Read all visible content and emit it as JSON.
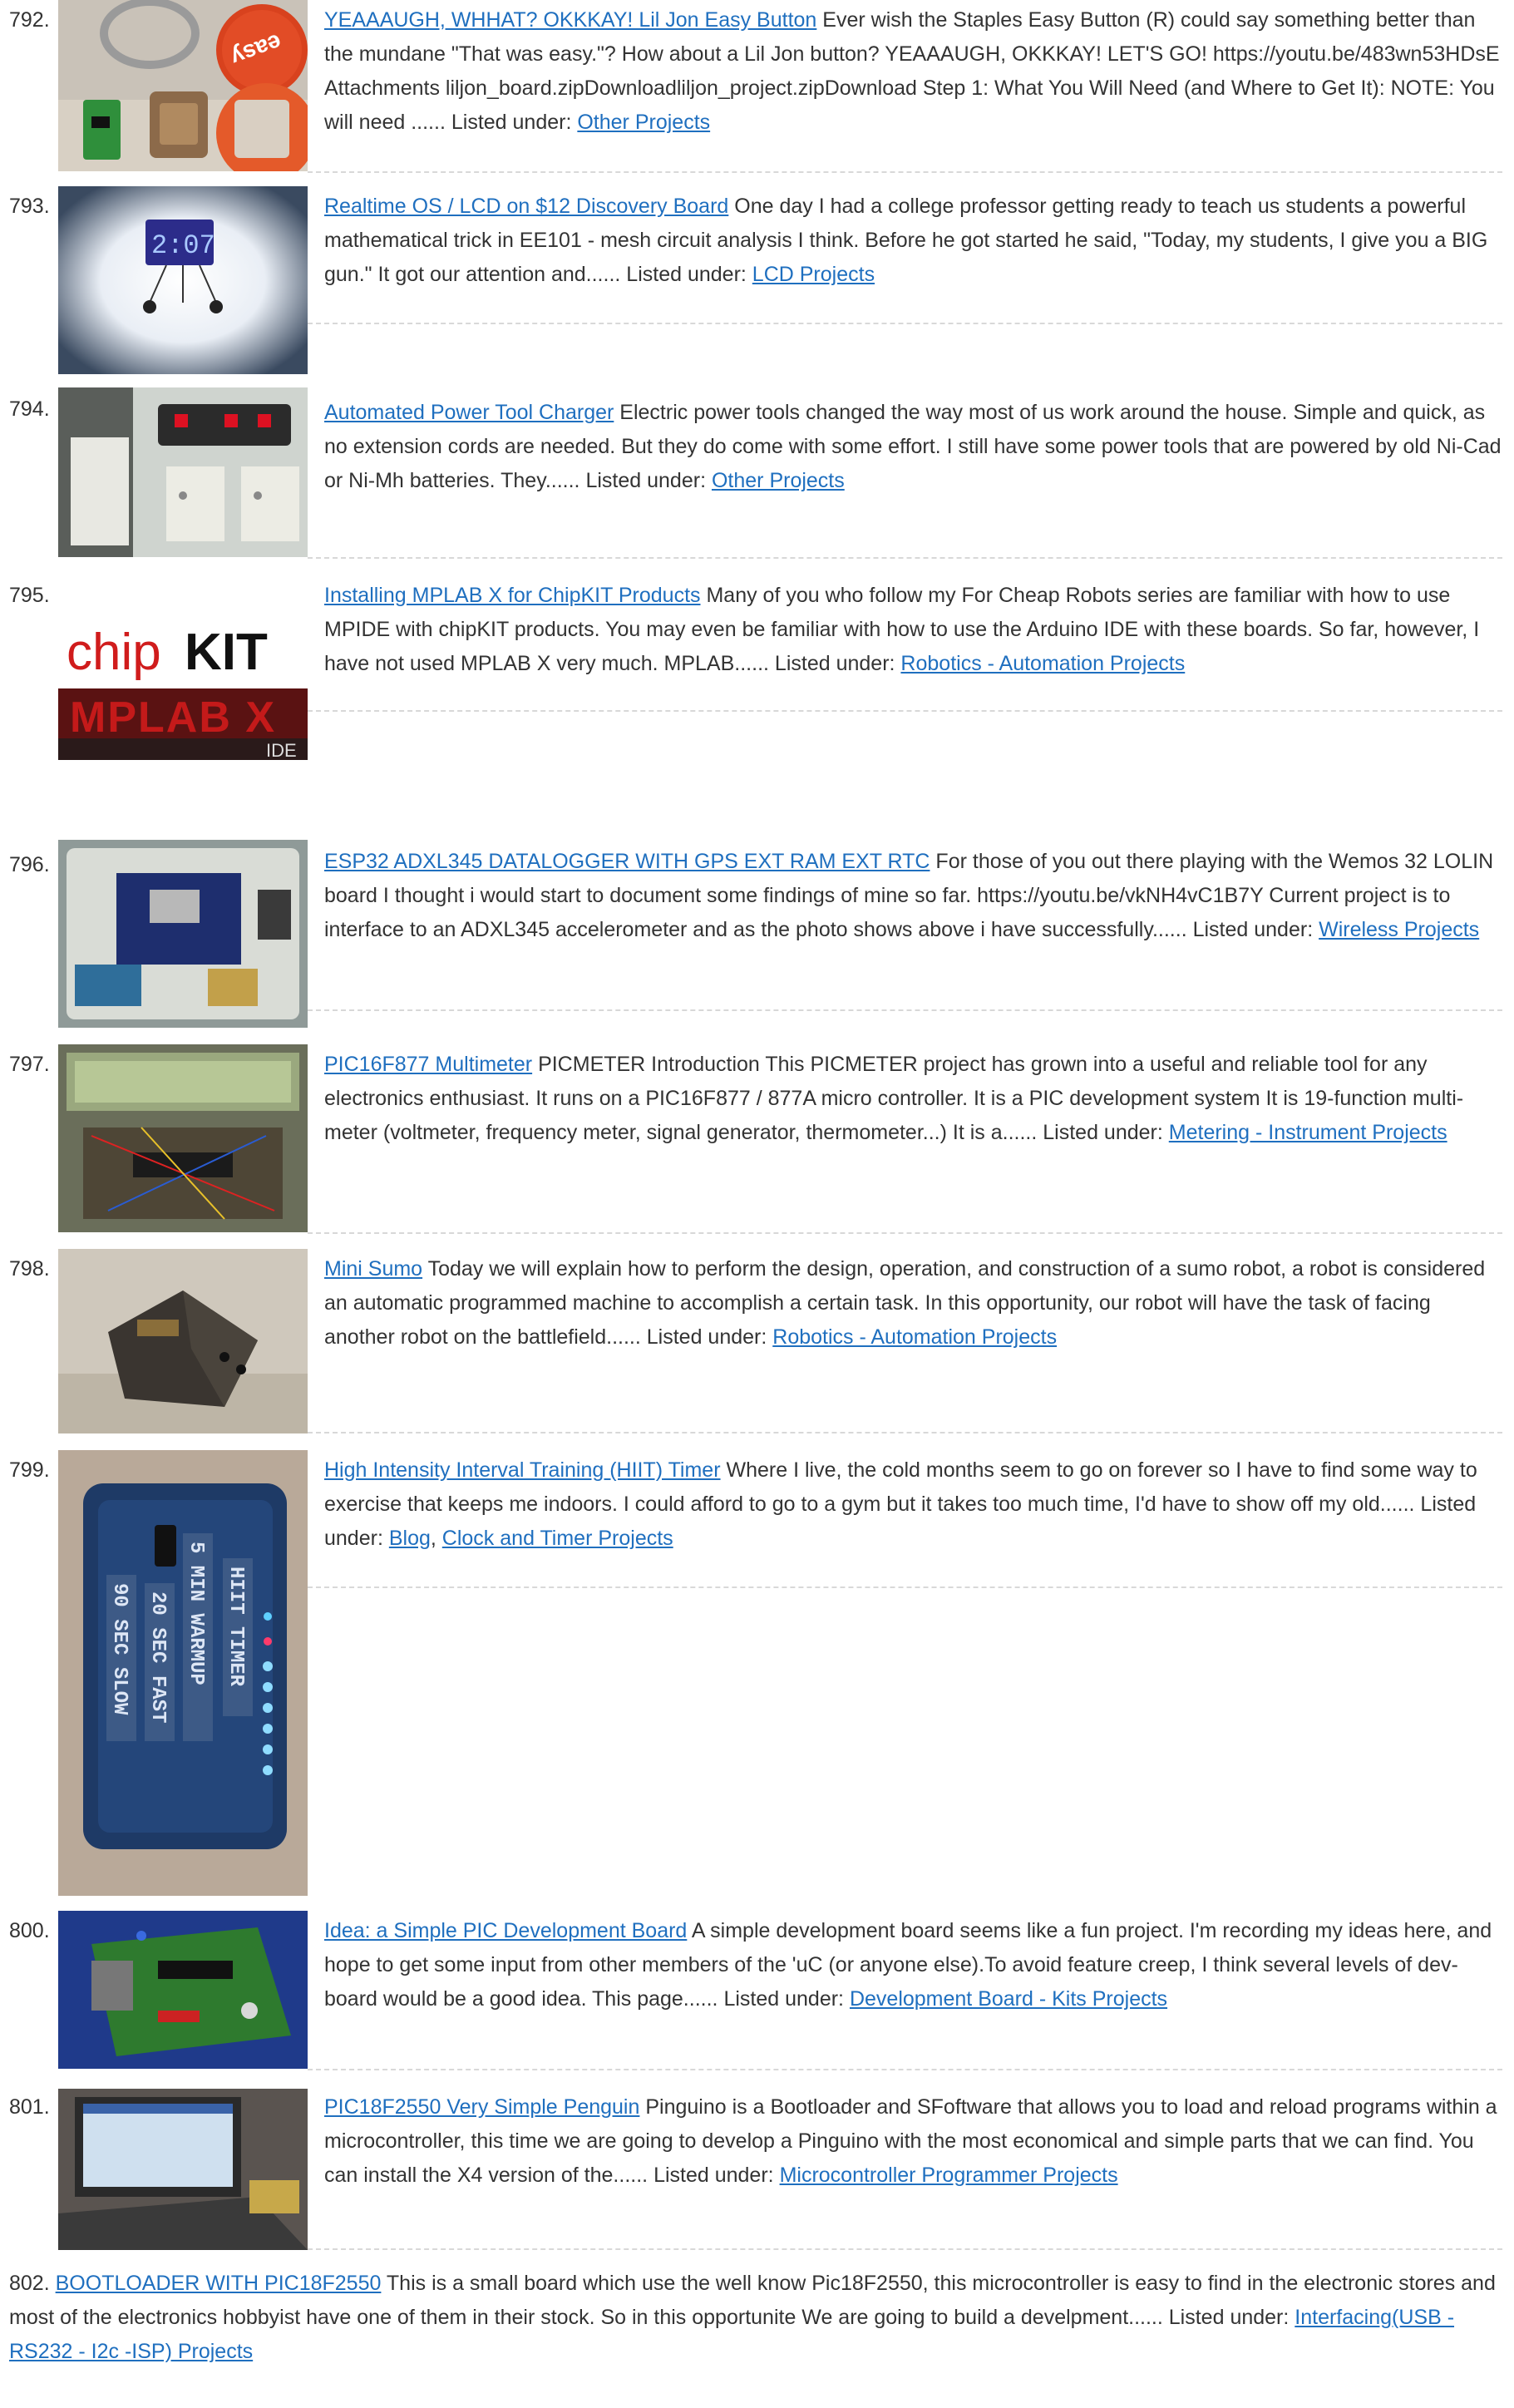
{
  "entries": [
    {
      "number": "792.",
      "title": "YEAAAUGH, WHHAT? OKKKAY! Lil Jon Easy Button",
      "description": "Ever wish the Staples Easy Button (R) could say something better than the mundane \"That was easy.\"? How about a Lil Jon button? YEAAAUGH, OKKKAY! LET'S GO! https://youtu.be/483wn53HDsE Attachments liljon_board.zipDownloadliljon_project.zipDownload Step 1: What You Will Need (and Where to Get It): NOTE: You will need ......",
      "listed_label": "Listed under:",
      "categories": [
        "Other Projects"
      ],
      "thumb_alt": "easy button parts"
    },
    {
      "number": "793.",
      "title": "Realtime OS / LCD on $12 Discovery Board",
      "description": "One day I had a college professor getting ready to teach us students a powerful mathematical trick in EE101 - mesh circuit analysis I think.  Before he got started he said, \"Today, my students, I give you a BIG gun.\"  It got our attention and......",
      "listed_label": "Listed under:",
      "categories": [
        "LCD Projects"
      ],
      "thumb_text": "2:07"
    },
    {
      "number": "794.",
      "title": "Automated Power Tool Charger",
      "description": "Electric power tools changed the way most of us work around the house. Simple and quick, as no extension cords are needed. But they do come with some effort. I still have some power tools that are powered by old Ni-Cad or Ni-Mh batteries. They......",
      "listed_label": "Listed under:",
      "categories": [
        "Other Projects"
      ]
    },
    {
      "number": "795.",
      "title": "Installing MPLAB X for ChipKIT Products",
      "description": "Many of you who follow my For Cheap Robots series are familiar with how to use MPIDE with chipKIT products. You may even be familiar with how to use the Arduino IDE with these boards. So far, however, I have not used MPLAB X very much. MPLAB......",
      "listed_label": "Listed under:",
      "categories": [
        "Robotics - Automation Projects"
      ],
      "logo_chip": "chip",
      "logo_kit": "KIT",
      "logo_mplab": "MPLAB X",
      "logo_ide": "IDE"
    },
    {
      "number": "796.",
      "title": "ESP32 ADXL345 DATALOGGER WITH GPS EXT RAM EXT RTC",
      "description": "For those of you out there playing with the Wemos 32 LOLIN board I thought i would start to document some findings of mine so far. https://youtu.be/vkNH4vC1B7Y Current project is to interface to an ADXL345 accelerometer and as the photo shows above i have successfully......",
      "listed_label": "Listed under:",
      "categories": [
        "Wireless Projects"
      ]
    },
    {
      "number": "797.",
      "title": "PIC16F877 Multimeter",
      "description": "PICMETER Introduction This PICMETER project has grown into a useful and reliable tool for any electronics enthusiast. It runs on a PIC16F877 / 877A micro controller. It is a PIC development system It is 19-function multi-meter (voltmeter, frequency meter, signal generator, thermometer...) It is a......",
      "listed_label": "Listed under:",
      "categories": [
        "Metering - Instrument Projects"
      ]
    },
    {
      "number": "798.",
      "title": "Mini Sumo",
      "description": "Today we will explain how to perform the design, operation, and construction of a sumo robot, a robot is considered an automatic programmed machine to accomplish a certain task. In this opportunity, our robot will have the task of facing another robot on the battlefield......",
      "listed_label": "Listed under:",
      "categories": [
        "Robotics - Automation Projects"
      ]
    },
    {
      "number": "799.",
      "title": "High Intensity Interval Training (HIIT) Timer",
      "description": "Where I live, the cold months seem to go on forever so I have to find some way to exercise that keeps me indoors. I could afford to go to a gym but it takes too much time, I'd have to show off my old......",
      "listed_label": "Listed under:",
      "categories": [
        "Blog",
        "Clock and Timer Projects"
      ],
      "labels": [
        "HIIT TIMER",
        "5 MIN WARMUP",
        "20 SEC FAST",
        "90 SEC SLOW"
      ]
    },
    {
      "number": "800.",
      "title": "Idea: a Simple PIC Development Board",
      "description": "A simple development board seems like a fun project. I'm recording my ideas here, and hope to get some input from other members of the 'uC (or anyone else).To avoid feature creep, I think several levels of dev-board would be a good idea. This page......",
      "listed_label": "Listed under:",
      "categories": [
        "Development Board - Kits Projects"
      ]
    },
    {
      "number": "801.",
      "title": "PIC18F2550 Very Simple Penguin",
      "description": "Pinguino is a Bootloader and SFoftware that allows you to load and reload programs within a microcontroller, this time we are going to develop a Pinguino with the most economical and simple parts that we can find. You can install the X4 version of the......",
      "listed_label": "Listed under:",
      "categories": [
        "Microcontroller Programmer Projects"
      ]
    },
    {
      "number": "802.",
      "title": "BOOTLOADER WITH PIC18F2550",
      "description": "This is a small board which use the well know Pic18F2550, this microcontroller is easy to find in the electronic stores and most of the electronics hobbyist have one of them in their stock. So in this opportunite We are going to build a develpment......",
      "listed_label": "Listed under:",
      "categories": [
        "Interfacing(USB - RS232 - I2c -ISP) Projects"
      ]
    }
  ]
}
